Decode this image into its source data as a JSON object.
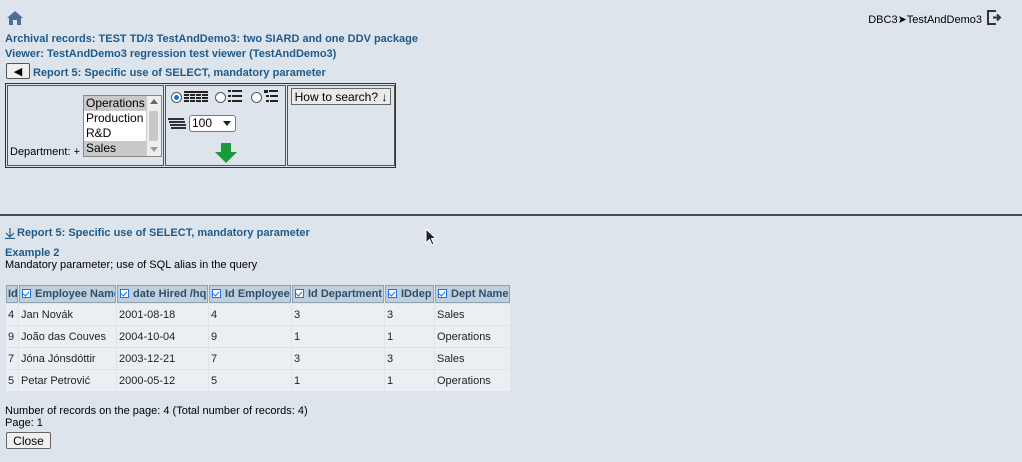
{
  "header": {
    "breadcrumb": "DBC3➤TestAndDemo3",
    "archival_records": "Archival records: TEST TD/3 TestAndDemo3: two SIARD and one DDV package",
    "viewer": "Viewer: TestAndDemo3 regression test viewer (TestAndDemo3)",
    "back_label": "◀",
    "report_title": "Report 5: Specific use of SELECT, mandatory parameter"
  },
  "search_form": {
    "department_label": "Department: +",
    "department_options": [
      {
        "label": "Operations",
        "selected": true
      },
      {
        "label": "Production",
        "selected": false
      },
      {
        "label": "R&D",
        "selected": false
      },
      {
        "label": "Sales",
        "selected": true
      }
    ],
    "view_modes": [
      "table-view",
      "list-view",
      "detail-view"
    ],
    "selected_view_mode": "table-view",
    "page_size": "100",
    "how_to_search_label": "How to search? ↓"
  },
  "results": {
    "report_title": "Report 5: Specific use of SELECT, mandatory parameter",
    "example_title": "Example 2",
    "example_desc": "Mandatory parameter; use of SQL alias in the query",
    "columns": [
      "Id",
      "Employee Name",
      "date Hired /hq",
      "Id Employee",
      "Id Department",
      "IDdep",
      "Dept Name"
    ],
    "rows": [
      [
        "4",
        "Jan Novák",
        "2001-08-18",
        "4",
        "3",
        "3",
        "Sales"
      ],
      [
        "9",
        "João das Couves",
        "2004-10-04",
        "9",
        "1",
        "1",
        "Operations"
      ],
      [
        "7",
        "Jóna Jónsdóttir",
        "2003-12-21",
        "7",
        "3",
        "3",
        "Sales"
      ],
      [
        "5",
        "Petar Petrović",
        "2000-05-12",
        "5",
        "1",
        "1",
        "Operations"
      ]
    ],
    "summary": "Number of records on the page: 4 (Total number of records: 4)",
    "page_info": "Page: 1",
    "close_label": "Close"
  },
  "colors": {
    "background": "#dde4ec",
    "link_blue": "#1f5a8a",
    "header_cell": "#c0cfdc",
    "row_cell": "#ebeff3",
    "search_arrow_green": "#1a9a3a"
  }
}
